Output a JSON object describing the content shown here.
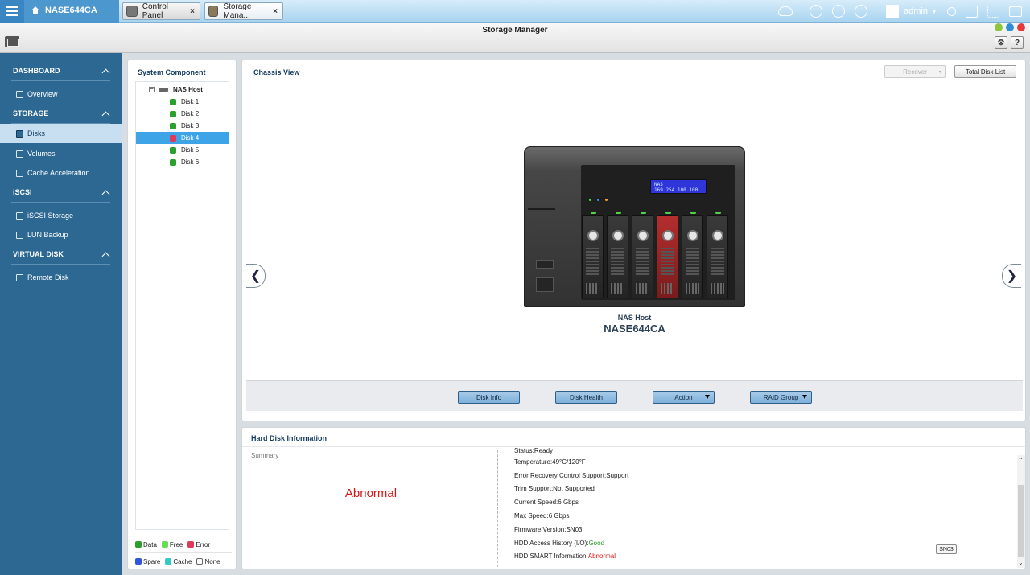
{
  "topbar": {
    "home_label": "NASE644CA",
    "tabs": [
      {
        "label": "Control Panel",
        "close": "×"
      },
      {
        "label": "Storage Mana...",
        "close": "×"
      }
    ],
    "user": "admin"
  },
  "window": {
    "title": "Storage Manager",
    "help_label": "?"
  },
  "nav": {
    "sections": [
      {
        "label": "DASHBOARD",
        "items": [
          "Overview"
        ]
      },
      {
        "label": "STORAGE",
        "items": [
          "Disks",
          "Volumes",
          "Cache Acceleration"
        ]
      },
      {
        "label": "iSCSI",
        "items": [
          "iSCSI Storage",
          "LUN Backup"
        ]
      },
      {
        "label": "VIRTUAL DISK",
        "items": [
          "Remote Disk"
        ]
      }
    ],
    "active": "Disks"
  },
  "system_component": {
    "title": "System Component",
    "root": "NAS Host",
    "disks": [
      "Disk 1",
      "Disk 2",
      "Disk 3",
      "Disk 4",
      "Disk 5",
      "Disk 6"
    ],
    "selected": "Disk 4",
    "legend": [
      "Data",
      "Free",
      "Error",
      "Spare",
      "Cache",
      "None"
    ]
  },
  "chassis": {
    "title": "Chassis View",
    "recover_label": "Recover",
    "total_disk_list_label": "Total Disk List",
    "lcd_line1": "NAS",
    "lcd_line2": "169.254.100.100",
    "host_label": "NAS Host",
    "host_name": "NASE644CA",
    "actions": [
      "Disk Info",
      "Disk Health",
      "Action",
      "RAID Group"
    ]
  },
  "hard_disk_info": {
    "title": "Hard Disk Information",
    "summary_label": "Summary",
    "summary_value": "Abnormal",
    "rows": [
      {
        "label": "Status: ",
        "value": "Ready"
      },
      {
        "label": "Temperature: ",
        "value": "49°C/120°F"
      },
      {
        "label": "Error Recovery Control Support: ",
        "value": "Support"
      },
      {
        "label": "Trim Support: ",
        "value": "Not Supported"
      },
      {
        "label": "Current Speed: ",
        "value": "6 Gbps"
      },
      {
        "label": "Max Speed: ",
        "value": "6 Gbps"
      },
      {
        "label": "Firmware Version: ",
        "value": "SN03"
      },
      {
        "label": "HDD Access History (I/O): ",
        "value": "Good"
      },
      {
        "label": "HDD SMART Information: ",
        "value": "Abnormal"
      }
    ],
    "firmware_badge": "SN03"
  },
  "colors": {
    "data": "#2ca02c",
    "free": "#66dd55",
    "error": "#e03a5a",
    "spare": "#3355dd",
    "cache": "#33c9c9",
    "none": "#ffffff",
    "selected_row": "#3ea4e8",
    "abnormal": "#d71818",
    "good": "#2a9a2a"
  }
}
